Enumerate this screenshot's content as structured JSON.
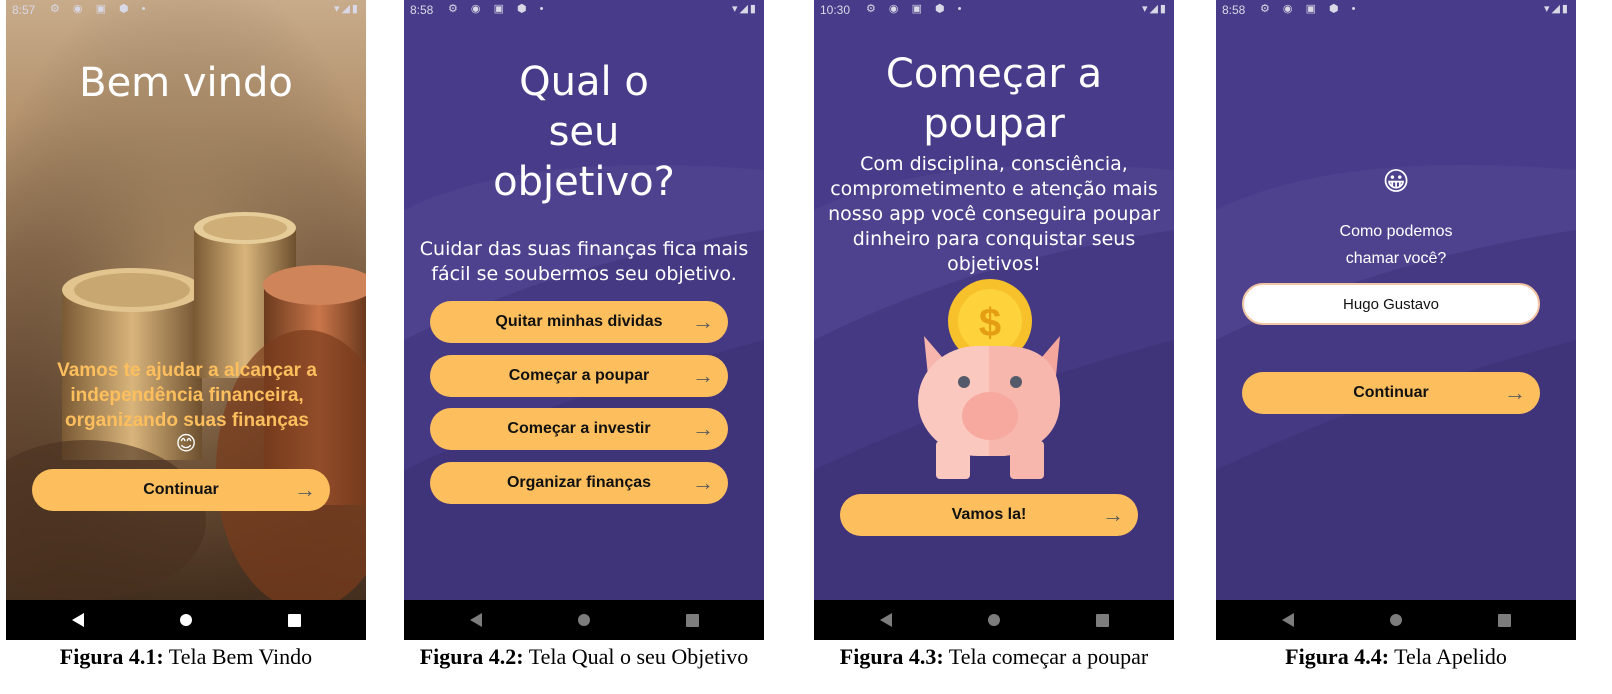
{
  "phones": [
    {
      "status": {
        "time": "8:57"
      },
      "title": "Bem vindo",
      "message": "Vamos te ajudar a alcançar a independência financeira, organizando suas finanças",
      "emoji": "😊",
      "button": "Continuar",
      "caption": {
        "label": "Figura 4.1:",
        "text": "Tela Bem Vindo"
      }
    },
    {
      "status": {
        "time": "8:58"
      },
      "title": "Qual o seu objetivo?",
      "subtitle": "Cuidar das suas finanças fica mais fácil se soubermos seu objetivo.",
      "options": [
        "Quitar minhas dividas",
        "Começar a poupar",
        "Começar a investir",
        "Organizar finanças"
      ],
      "caption": {
        "label": "Figura 4.2:",
        "text": "Tela Qual o seu Objetivo"
      }
    },
    {
      "status": {
        "time": "10:30"
      },
      "title": "Começar a poupar",
      "message": "Com disciplina, consciência, comprometimento e atenção mais nosso app você conseguira poupar dinheiro para conquistar seus objetivos!",
      "coin_symbol": "$",
      "button": "Vamos la!",
      "caption": {
        "label": "Figura 4.3:",
        "text": "Tela começar a poupar"
      }
    },
    {
      "status": {
        "time": "8:58"
      },
      "emoji": "😀",
      "question": "Como podemos chamar você?",
      "input_value": "Hugo Gustavo",
      "button": "Continuar",
      "caption": {
        "label": "Figura 4.4:",
        "text": "Tela Apelido"
      }
    }
  ],
  "icons": {
    "arrow": "→",
    "status_left": "⚙ ◉ ▣ ⬢ •",
    "status_right": "▾◢▮"
  },
  "colors": {
    "purple": "#483c8a",
    "button": "#fdbf5e",
    "title_orange": "#fdbf5e"
  }
}
